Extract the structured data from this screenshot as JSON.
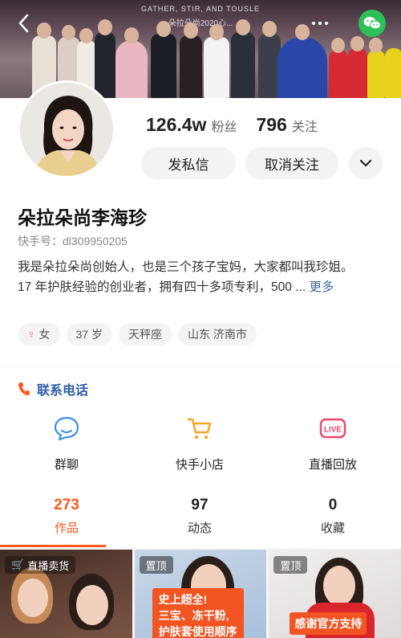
{
  "banner": {
    "stage_line1": "GATHER, STIR, AND TOUSLE",
    "stage_line2": "朵拉朵尚2020心...",
    "icons": {
      "back": "back-arrow-icon",
      "more": "more-dots-icon",
      "share": "wechat-icon"
    }
  },
  "profile": {
    "followers_count": "126.4w",
    "followers_label": "粉丝",
    "following_count": "796",
    "following_label": "关注",
    "message_button": "发私信",
    "unfollow_button": "取消关注",
    "name": "朵拉朵尚李海珍",
    "kuaishou_id": "快手号：dl309950205",
    "bio_line1": "我是朵拉朵尚创始人，也是三个孩子宝妈，大家都叫我珍姐。",
    "bio_line2": "17 年护肤经验的创业者，拥有四十多项专利，500 ... ",
    "bio_more": "更多",
    "tags": {
      "gender": "女",
      "age": "37 岁",
      "zodiac": "天秤座",
      "location": "山东 济南市"
    }
  },
  "contact": {
    "label": "联系电话",
    "icon": "phone-icon"
  },
  "features": [
    {
      "label": "群聊",
      "icon": "chat-bubble-icon"
    },
    {
      "label": "快手小店",
      "icon": "shopping-cart-icon"
    },
    {
      "label": "直播回放",
      "icon": "live-icon"
    }
  ],
  "tabs": [
    {
      "count": "273",
      "label": "作品",
      "active": true
    },
    {
      "count": "97",
      "label": "动态",
      "active": false
    },
    {
      "count": "0",
      "label": "收藏",
      "active": false
    }
  ],
  "thumbnails": [
    {
      "badge": "直播卖货"
    },
    {
      "badge": "置顶",
      "promo_line1": "史上超全!",
      "promo_line2": "三宝、冻干粉,",
      "promo_line3": "护肤套使用顺序"
    },
    {
      "badge": "置顶",
      "promo_line1": "感谢官方支持"
    }
  ],
  "colors": {
    "accent": "#ff5a1f",
    "link": "#2b5da8",
    "wechat": "#2bc157"
  }
}
